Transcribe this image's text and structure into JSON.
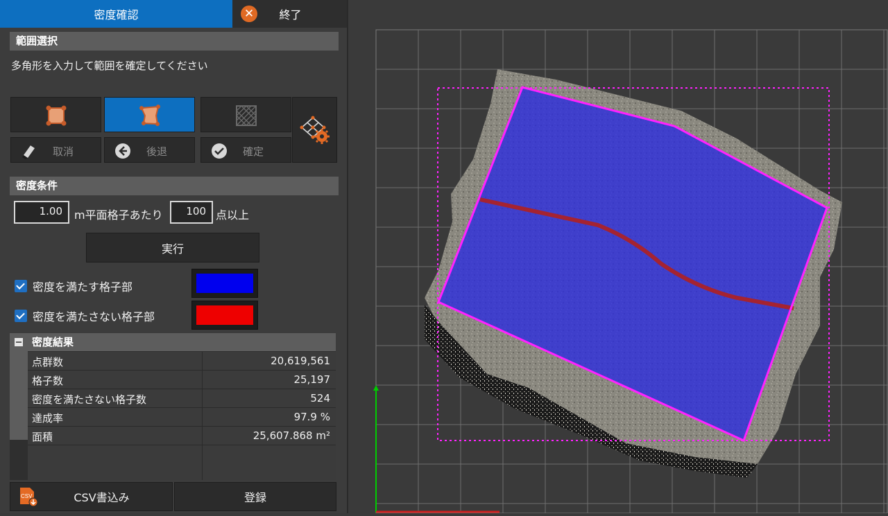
{
  "header": {
    "tab_active": "密度確認",
    "exit_label": "終了"
  },
  "range": {
    "title": "範囲選択",
    "hint": "多角形を入力して範囲を確定してください"
  },
  "actions": {
    "cancel": "取消",
    "undo": "後退",
    "confirm": "確定"
  },
  "density": {
    "title": "密度条件",
    "grid_size": "1.00",
    "per_grid_label": "m平面格子あたり",
    "min_points": "100",
    "points_label": "点以上",
    "run": "実行"
  },
  "legend": {
    "satisfy_label": "密度を満たす格子部",
    "satisfy_color": "#0000ee",
    "fail_label": "密度を満たさない格子部",
    "fail_color": "#ee0000"
  },
  "results": {
    "title": "密度結果",
    "rows": [
      {
        "key": "点群数",
        "value": "20,619,561"
      },
      {
        "key": "格子数",
        "value": "25,197"
      },
      {
        "key": "密度を満たさない格子数",
        "value": "524"
      },
      {
        "key": "達成率",
        "value": "97.9 %"
      },
      {
        "key": "面積",
        "value": "25,607.868 m²"
      }
    ]
  },
  "footer": {
    "csv": "CSV書込み",
    "csv_icon_text": "CSV",
    "register": "登録"
  },
  "colors": {
    "accent": "#0d6fc0",
    "polygon": "#ff22ff",
    "bbox": "#ff22ff"
  }
}
